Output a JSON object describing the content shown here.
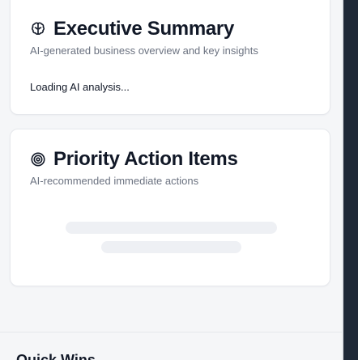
{
  "summary": {
    "title": "Executive Summary",
    "subtitle": "AI-generated business overview and key insights",
    "loading_text": "Loading AI analysis...",
    "icon": "brain-icon"
  },
  "actions": {
    "title": "Priority Action Items",
    "subtitle": "AI-recommended immediate actions",
    "icon": "target-icon"
  },
  "next_section": {
    "title": "Quick Wins"
  },
  "colors": {
    "page_background": "#f5f6f8",
    "card_background": "#ffffff",
    "title": "#111827",
    "subtitle": "#6b7280",
    "skeleton": "#eef0f4",
    "right_panel": "#1f2937"
  }
}
